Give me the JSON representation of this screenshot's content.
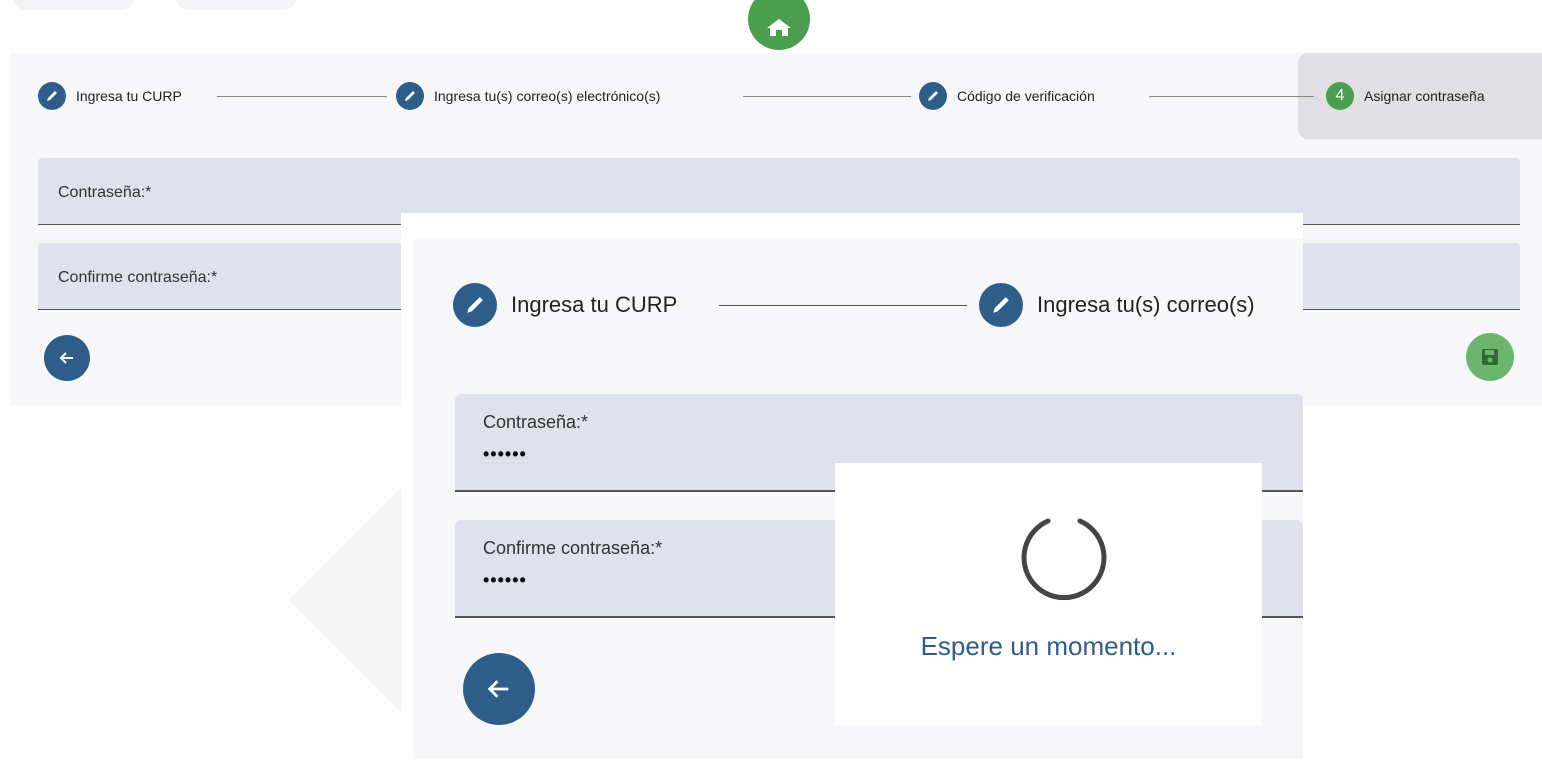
{
  "stepper": {
    "steps": [
      {
        "label": "Ingresa tu CURP",
        "state": "done"
      },
      {
        "label": "Ingresa tu(s) correo(s) electrónico(s)",
        "state": "done"
      },
      {
        "label": "Código de verificación",
        "state": "done"
      },
      {
        "label": "Asignar contraseña",
        "state": "active",
        "number": "4"
      }
    ]
  },
  "form": {
    "password_label": "Contraseña:*",
    "confirm_label": "Confirme contraseña:*"
  },
  "zoom": {
    "step1": "Ingresa tu CURP",
    "step2": "Ingresa tu(s) correo(s)",
    "password_label": "Contraseña:*",
    "password_value": "••••••",
    "confirm_label": "Confirme contraseña:*",
    "confirm_value": "••••••"
  },
  "loader": {
    "message": "Espere un momento..."
  },
  "colors": {
    "primary": "#2f5d8a",
    "success": "#4a9e4e",
    "field_bg": "#dfe1ec"
  },
  "icons": [
    "home-icon",
    "pencil-icon",
    "arrow-left-icon",
    "floppy-disk-icon",
    "spinner-icon"
  ]
}
